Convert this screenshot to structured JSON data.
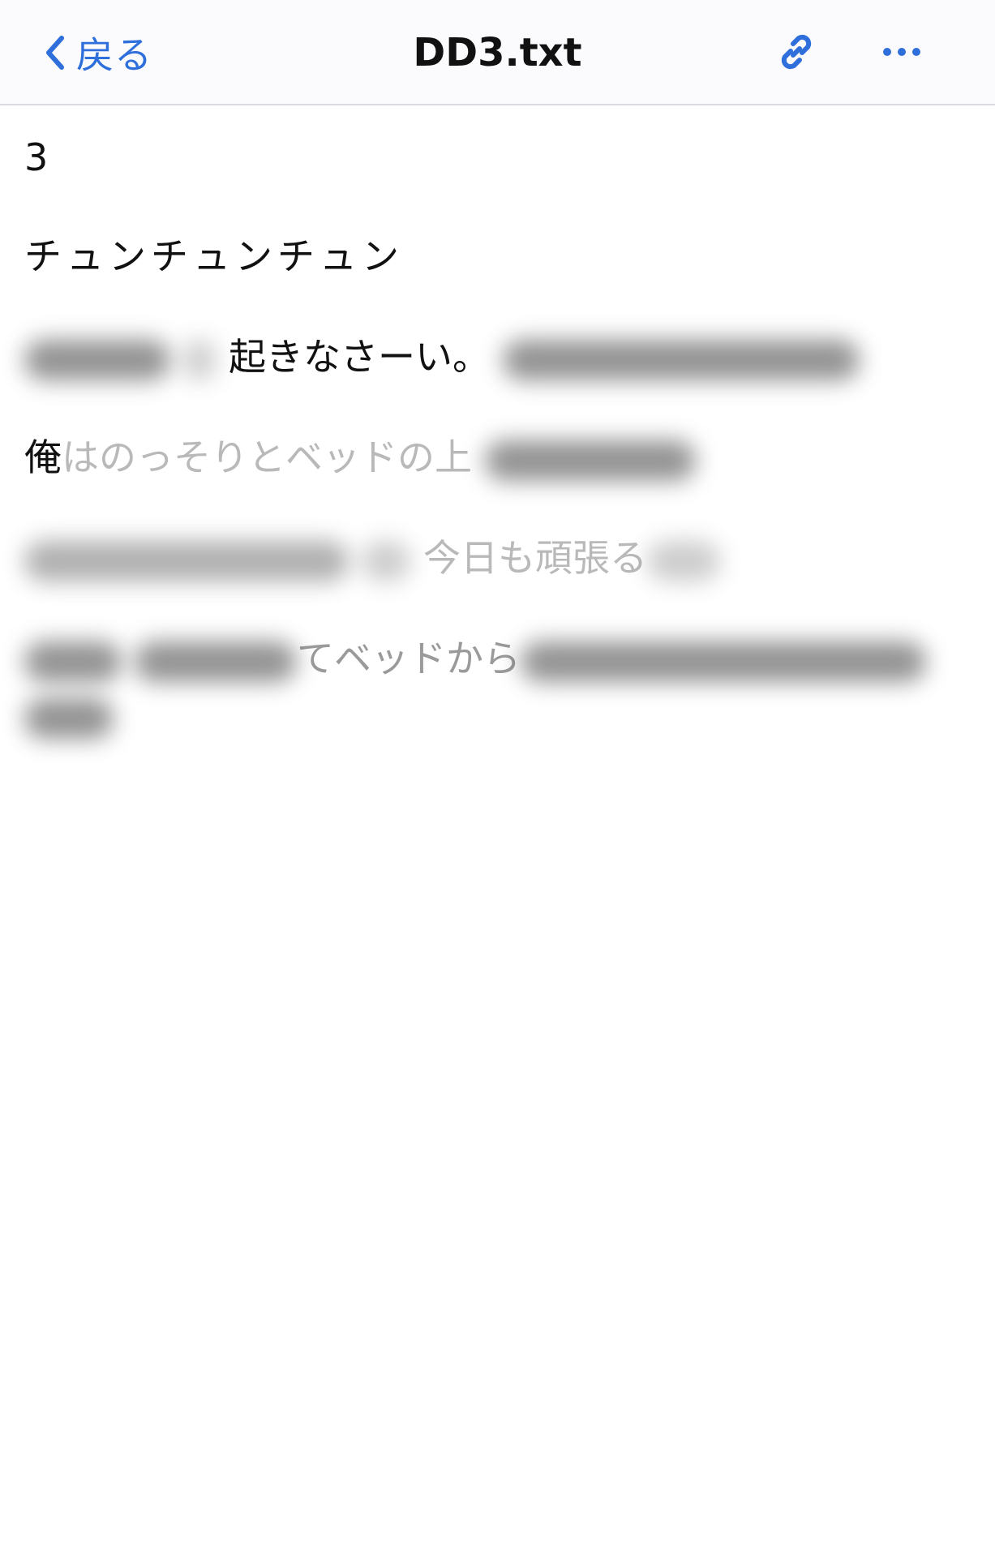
{
  "navbar": {
    "back_label": "戻る",
    "title": "DD3.txt",
    "accent_color": "#2f6fdb",
    "icons": {
      "back": "chevron-left-icon",
      "link": "link-icon",
      "more": "ellipsis-icon"
    }
  },
  "document": {
    "line1": "3",
    "line2": "チュンチュンチュン",
    "line3_visible": "起きなさーい。",
    "line4_visible_dark": "俺",
    "line4_visible_fade": "はのっそりとベッドの上",
    "line5_visible": "今日も頑張る",
    "line6_visible": "てベッドから"
  }
}
